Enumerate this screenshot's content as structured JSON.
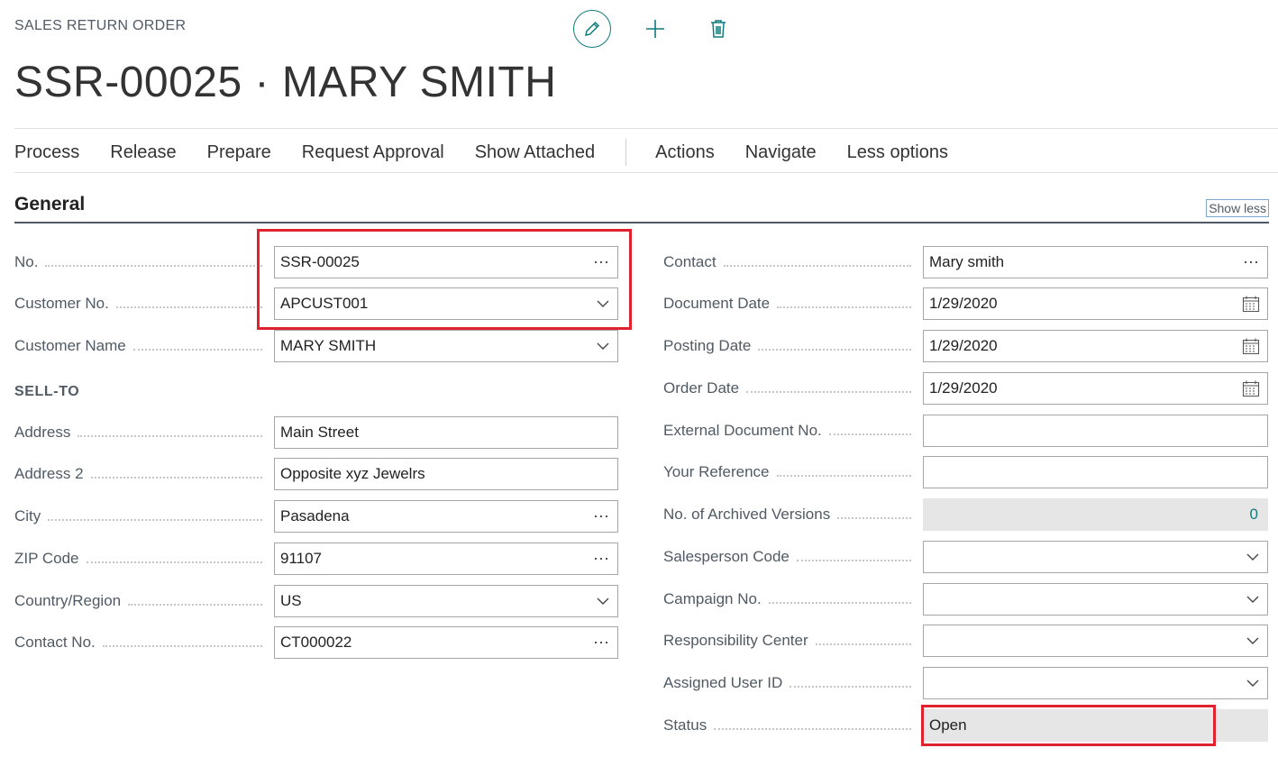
{
  "header": {
    "caption": "SALES RETURN ORDER",
    "title": "SSR-00025 · MARY SMITH",
    "edit_icon": "pencil-icon",
    "new_icon": "plus-icon",
    "delete_icon": "trash-icon"
  },
  "menu": {
    "items": [
      "Process",
      "Release",
      "Prepare",
      "Request Approval",
      "Show Attached"
    ],
    "items2": [
      "Actions",
      "Navigate",
      "Less options"
    ]
  },
  "section": {
    "title": "General",
    "show_less": "Show less",
    "sell_to": "SELL-TO"
  },
  "left_fields": [
    {
      "label": "No.",
      "value": "SSR-00025",
      "control": "ellipsis"
    },
    {
      "label": "Customer No.",
      "value": "APCUST001",
      "control": "chevron"
    },
    {
      "label": "Customer Name",
      "value": "MARY SMITH",
      "control": "chevron"
    },
    {
      "label": "Address",
      "value": "Main Street",
      "control": "none"
    },
    {
      "label": "Address 2",
      "value": "Opposite xyz Jewelrs",
      "control": "none"
    },
    {
      "label": "City",
      "value": "Pasadena",
      "control": "ellipsis"
    },
    {
      "label": "ZIP Code",
      "value": "91107",
      "control": "ellipsis"
    },
    {
      "label": "Country/Region",
      "value": "US",
      "control": "chevron"
    },
    {
      "label": "Contact No.",
      "value": "CT000022",
      "control": "ellipsis"
    }
  ],
  "right_fields": [
    {
      "label": "Contact",
      "value": "Mary smith",
      "control": "ellipsis"
    },
    {
      "label": "Document Date",
      "value": "1/29/2020",
      "control": "calendar"
    },
    {
      "label": "Posting Date",
      "value": "1/29/2020",
      "control": "calendar"
    },
    {
      "label": "Order Date",
      "value": "1/29/2020",
      "control": "calendar"
    },
    {
      "label": "External Document No.",
      "value": "",
      "control": "none"
    },
    {
      "label": "Your Reference",
      "value": "",
      "control": "none"
    },
    {
      "label": "No. of Archived Versions",
      "value": "0",
      "control": "readonly-number"
    },
    {
      "label": "Salesperson Code",
      "value": "",
      "control": "chevron"
    },
    {
      "label": "Campaign No.",
      "value": "",
      "control": "chevron"
    },
    {
      "label": "Responsibility Center",
      "value": "",
      "control": "chevron"
    },
    {
      "label": "Assigned User ID",
      "value": "",
      "control": "chevron"
    },
    {
      "label": "Status",
      "value": "Open",
      "control": "readonly"
    }
  ],
  "colors": {
    "accent": "#0f7b7b",
    "highlight": "#e02230"
  }
}
